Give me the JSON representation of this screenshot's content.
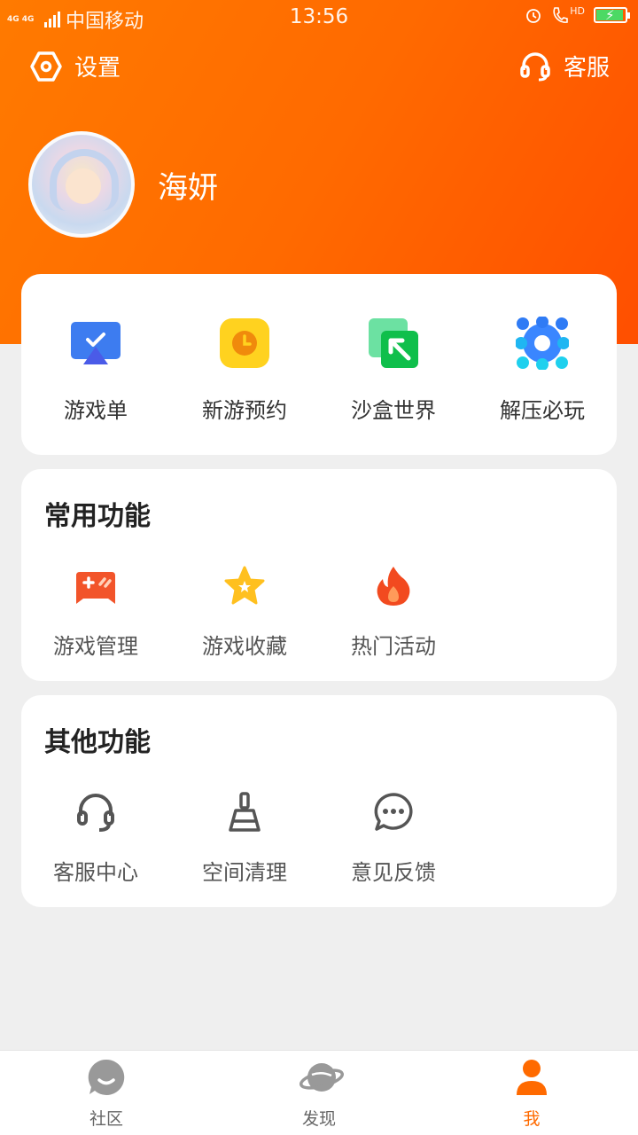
{
  "status_bar": {
    "network": "4G 4G",
    "carrier": "中国移动",
    "time": "13:56",
    "hd_label": "HD"
  },
  "top_nav": {
    "settings_label": "设置",
    "service_label": "客服"
  },
  "profile": {
    "username": "海妍"
  },
  "quick_entries": [
    {
      "label": "游戏单",
      "icon": "game-list-icon",
      "color": "#3d7cf0"
    },
    {
      "label": "新游预约",
      "icon": "clock-icon",
      "color": "#ffd21f"
    },
    {
      "label": "沙盒世界",
      "icon": "sandbox-cursor-icon",
      "color": "#19c25a"
    },
    {
      "label": "解压必玩",
      "icon": "dots-gear-icon",
      "color": "#3a86ff"
    }
  ],
  "common_functions": {
    "title": "常用功能",
    "items": [
      {
        "label": "游戏管理",
        "icon": "gamepad-icon"
      },
      {
        "label": "游戏收藏",
        "icon": "star-icon"
      },
      {
        "label": "热门活动",
        "icon": "flame-icon"
      }
    ]
  },
  "other_functions": {
    "title": "其他功能",
    "items": [
      {
        "label": "客服中心",
        "icon": "headset-icon"
      },
      {
        "label": "空间清理",
        "icon": "broom-icon"
      },
      {
        "label": "意见反馈",
        "icon": "chat-bubble-icon"
      }
    ]
  },
  "tab_bar": {
    "tabs": [
      {
        "label": "社区",
        "icon": "community-icon",
        "active": false
      },
      {
        "label": "发现",
        "icon": "planet-icon",
        "active": false
      },
      {
        "label": "我",
        "icon": "person-icon",
        "active": true
      }
    ]
  },
  "colors": {
    "accent": "#ff6a00",
    "header_start": "#ff7a00",
    "header_end": "#ff4f00",
    "page_bg": "#efefef"
  }
}
